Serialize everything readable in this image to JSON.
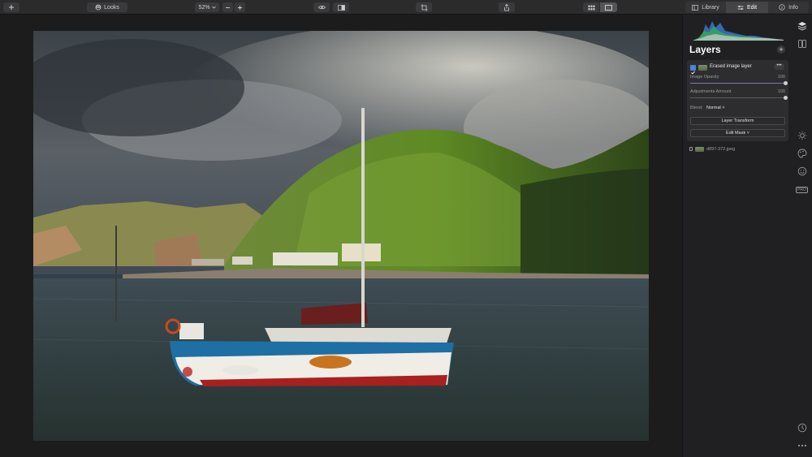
{
  "toolbar": {
    "add_icon": "plus-icon",
    "looks_label": "Looks",
    "zoom_value": "52%",
    "zoom_out_icon": "minus-icon",
    "zoom_in_icon": "plus-icon",
    "preview_icon": "eye-icon",
    "compare_icon": "compare-icon",
    "crop_icon": "crop-icon",
    "share_icon": "share-icon",
    "grid_view_icon": "grid-icon",
    "single_view_icon": "single-view-icon",
    "tabs": [
      {
        "label": "Library",
        "icon": "library-icon",
        "active": false
      },
      {
        "label": "Edit",
        "icon": "sliders-icon",
        "active": true
      },
      {
        "label": "Info",
        "icon": "info-icon",
        "active": false
      }
    ]
  },
  "panel": {
    "title": "Layers",
    "active_layer": {
      "name": "Erased image layer",
      "checked": true,
      "more_label": "•••",
      "image_opacity_label": "Image Opacity",
      "image_opacity_value": "100",
      "image_opacity": 1.0,
      "adjustments_label": "Adjustments Amount",
      "adjustments_value": "100",
      "adjustments": 1.0,
      "blend_label": "Blend:",
      "blend_value": "Normal ˅",
      "transform_button": "Layer Transform",
      "mask_button": "Edit Mask ˅"
    },
    "base_layer": {
      "name": "d897-372.jpeg",
      "locked": true
    }
  },
  "side_icons": [
    "layers-icon",
    "panels-icon",
    "sun-icon",
    "palette-icon",
    "face-icon",
    "pro-icon",
    "history-icon",
    "more-icon"
  ],
  "side_pro_label": "PRO",
  "colors": {
    "accent": "#4b84d9",
    "panel_bg": "#202022",
    "toolbar_bg": "#2b2b2c"
  }
}
